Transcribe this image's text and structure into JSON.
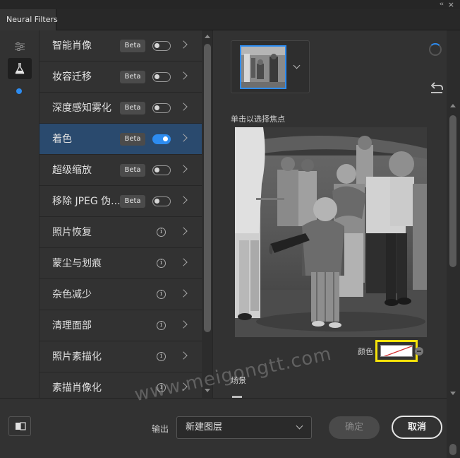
{
  "window": {
    "tab_title": "Neural Filters",
    "collapse_glyph": "‹‹",
    "close_glyph": "×"
  },
  "filters": [
    {
      "label": "智能肖像",
      "badge": "Beta",
      "toggle": "off"
    },
    {
      "label": "妆容迁移",
      "badge": "Beta",
      "toggle": "off"
    },
    {
      "label": "深度感知雾化",
      "badge": "Beta",
      "toggle": "off"
    },
    {
      "label": "着色",
      "badge": "Beta",
      "toggle": "on"
    },
    {
      "label": "超级缩放",
      "badge": "Beta",
      "toggle": "off"
    },
    {
      "label": "移除 JPEG 伪...",
      "badge": "Beta",
      "toggle": "off"
    },
    {
      "label": "照片恢复",
      "info_glyph": "i"
    },
    {
      "label": "蒙尘与划痕",
      "info_glyph": "i"
    },
    {
      "label": "杂色减少",
      "info_glyph": "i"
    },
    {
      "label": "清理面部",
      "info_glyph": "i"
    },
    {
      "label": "照片素描化",
      "info_glyph": "i"
    },
    {
      "label": "素描肖像化",
      "info_glyph": "i"
    }
  ],
  "right_panel": {
    "click_hint": "单击以选择焦点",
    "color_label": "颜色",
    "scene_label": "场景"
  },
  "footer": {
    "output_label": "输出",
    "output_value": "新建图层",
    "ok_label": "确定",
    "cancel_label": "取消"
  },
  "watermark": "www.meigongtt.com",
  "colors": {
    "accent": "#2d8cf0",
    "highlight": "#f5e20a",
    "selected_row": "#2a4a6e"
  }
}
